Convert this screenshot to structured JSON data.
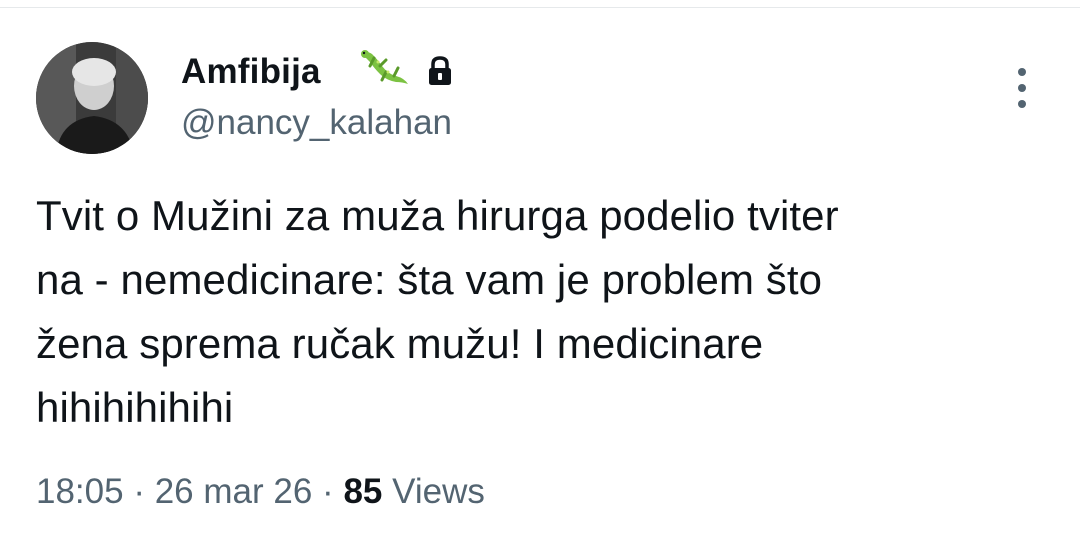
{
  "author": {
    "display_name": "Amfibija",
    "badge_emoji_icon": "lizard-icon",
    "protected_icon": "lock-icon",
    "handle": "@nancy_kalahan"
  },
  "tweet": {
    "lines": [
      "Tvit o Mužini za muža hirurga podelio tviter",
      "na - nemedicinare: šta vam je problem što",
      "žena sprema ručak mužu! I medicinare",
      "hihihihihihi"
    ]
  },
  "meta": {
    "time": "18:05",
    "separator": "·",
    "date": "26 mar 26",
    "views_count": "85",
    "views_label": "Views"
  },
  "colors": {
    "text": "#0f1419",
    "secondary": "#536471",
    "lizard": "#7cc242"
  }
}
